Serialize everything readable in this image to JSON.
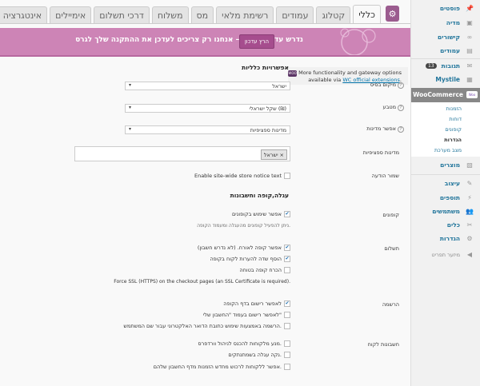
{
  "tabs": [
    {
      "label": "כללי",
      "active": true
    },
    {
      "label": "קטלוג"
    },
    {
      "label": "עמודים"
    },
    {
      "label": "רשימת מלאי"
    },
    {
      "label": "מס"
    },
    {
      "label": "משלוח"
    },
    {
      "label": "דרכי תשלום"
    },
    {
      "label": "אימיילים"
    },
    {
      "label": "אינטגרציה"
    }
  ],
  "banner": {
    "text": "נדרש עדכון נתונים – אנחנו רק צריכים לעדכן את ההתקנה שלך לגרס",
    "button": "הרץ עדכון"
  },
  "notice": {
    "line1": "More functionality and gateway options",
    "line2_prefix": "available via ",
    "line2_link": "WC official extensions",
    "line2_suffix": "."
  },
  "general": {
    "heading": "אפשרויות כלליות",
    "base_location": {
      "label": "מיקום בסיס",
      "value": "ישראל"
    },
    "currency": {
      "label": "מטבע",
      "value": "שקל ישראלי (₪)"
    },
    "allowed_countries": {
      "label": "אפשר מדינות",
      "value": "מדינות ספציפיות"
    },
    "specific_countries": {
      "label": "מדינות ספציפיות",
      "tag": "ישראל",
      "remove": "×"
    },
    "store_notice": {
      "label": "שמור הודעה",
      "checkbox": "Enable site-wide store notice text"
    }
  },
  "cart": {
    "heading": "עגלה,קופה וחשבונות",
    "coupons": {
      "label": "קופונים",
      "checkbox": "אפשר שימוש בקופונים",
      "desc": "ניתן להפעיל קופונים מהעגלה ומעמוד הקופה."
    },
    "checkout": {
      "label": "תשלום",
      "items": [
        {
          "text": "אפשר קופה לאורח. (לא נדרש חשבון)",
          "checked": true
        },
        {
          "text": "הוסף שדה להערות לקוח בקופה",
          "checked": true
        },
        {
          "text": "הכרח קופה בטוחה",
          "checked": false
        }
      ],
      "desc": "Force SSL (HTTPS) on the checkout pages (an SSL Certificate is required)."
    },
    "registration": {
      "label": "הרשמה",
      "items": [
        {
          "text": "לאפשר רישום בדף הקופה",
          "checked": true
        },
        {
          "text": "לאפשר רישום בעמוד \"החשבון שלי\"",
          "checked": false
        },
        {
          "text": "הרשמה באמצעות שימוש כתובת הדואר האלקטרוני עבור שם המשתמש.",
          "checked": false
        }
      ]
    },
    "accounts": {
      "label": "חשבונות לקוח",
      "items": [
        {
          "text": "מנע מלקוחות להכנס לניהול וורדפרס.",
          "checked": false
        },
        {
          "text": "נקה עגלה בשמתנתקים.",
          "checked": false
        },
        {
          "text": "אפשר ללקוחות לרכוש מחדש הזמנות מדף החשבון שלהם.",
          "checked": false
        }
      ]
    }
  },
  "sidebar": {
    "items": [
      {
        "label": "פוסטים",
        "icon": "pin-icon"
      },
      {
        "label": "מדיה",
        "icon": "media-icon"
      },
      {
        "label": "קישורים",
        "icon": "link-icon"
      },
      {
        "label": "עמודים",
        "icon": "page-icon"
      },
      {
        "label": "תגובות",
        "icon": "comment-icon",
        "badge": "13"
      },
      {
        "label": "Mystile",
        "icon": "theme-icon"
      }
    ],
    "woocommerce": {
      "label": "WooCommerce",
      "icon_text": "Woo"
    },
    "woo_sub": [
      {
        "label": "הזמנות"
      },
      {
        "label": "דוחות"
      },
      {
        "label": "קופונים"
      },
      {
        "label": "הגדרות",
        "current": true
      },
      {
        "label": "מצב מערכת"
      }
    ],
    "items2": [
      {
        "label": "מוצרים",
        "icon": "products-icon"
      },
      {
        "label": "עיצוב",
        "icon": "appearance-icon"
      },
      {
        "label": "תוספים",
        "icon": "plugins-icon"
      },
      {
        "label": "משתמשים",
        "icon": "users-icon"
      },
      {
        "label": "כלים",
        "icon": "tools-icon"
      },
      {
        "label": "הגדרות",
        "icon": "settings-icon"
      }
    ],
    "collapse": "מיזער תפריט"
  },
  "colors": {
    "accent": "#9b5c8f",
    "banner": "#cd84b6",
    "link": "#21759b"
  }
}
